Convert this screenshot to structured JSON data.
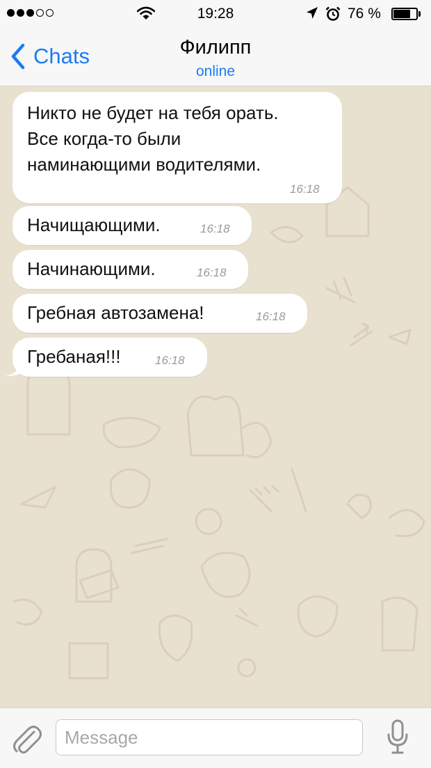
{
  "status_bar": {
    "signal_bars_filled": 3,
    "signal_bars_total": 5,
    "time": "19:28",
    "battery_text": "76 %",
    "battery_level": 0.76,
    "icons": [
      "signal-dots-icon",
      "wifi-icon",
      "location-arrow-icon",
      "alarm-icon",
      "battery-icon"
    ]
  },
  "header": {
    "back_label": "Chats",
    "contact_name": "Филипп",
    "contact_status": "online"
  },
  "messages": [
    {
      "lines": [
        "Никто не будет на тебя орать.",
        "Все когда-то были",
        "наминающими водителями."
      ],
      "time": "16:18"
    },
    {
      "text": "Начищающими.",
      "time": "16:18"
    },
    {
      "text": "Начинающими.",
      "time": "16:18"
    },
    {
      "text": "Гребная автозамена!",
      "time": "16:18"
    },
    {
      "text": "Гребаная!!!",
      "time": "16:18"
    }
  ],
  "composer": {
    "placeholder": "Message",
    "value": ""
  },
  "colors": {
    "accent": "#1b7cf2",
    "chat_background": "#e9e1cf",
    "bar_background": "#f7f7f7",
    "bubble": "#ffffff"
  }
}
